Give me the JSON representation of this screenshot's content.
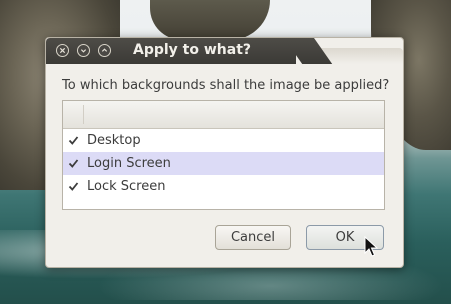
{
  "dialog": {
    "title": "Apply to what?",
    "prompt": "To which backgrounds shall the image be applied?",
    "items": [
      {
        "label": "Desktop",
        "checked": true,
        "selected": false
      },
      {
        "label": "Login Screen",
        "checked": true,
        "selected": true
      },
      {
        "label": "Lock Screen",
        "checked": true,
        "selected": false
      }
    ],
    "buttons": {
      "cancel": "Cancel",
      "ok": "OK"
    }
  },
  "window_controls": [
    "close-icon",
    "minimize-icon",
    "maximize-icon"
  ],
  "colors": {
    "titlebar": "#3f3e3a",
    "dialog_bg": "#f1efea",
    "selected_row": "#dcdbf6"
  }
}
